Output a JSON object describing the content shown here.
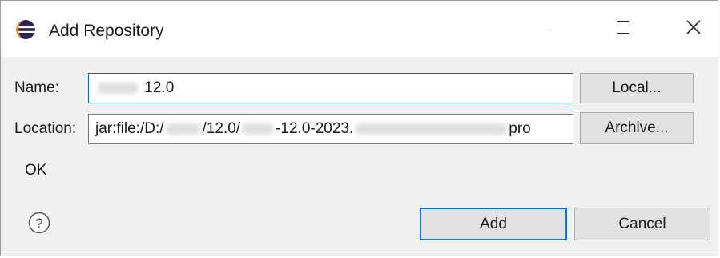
{
  "window": {
    "title": "Add Repository",
    "controls": {
      "minimize": "minimize-icon",
      "maximize": "maximize-icon",
      "close": "close-icon"
    }
  },
  "form": {
    "name_label": "Name:",
    "name_value": "12.0",
    "location_label": "Location:",
    "location_parts": [
      "jar:file:/D:/",
      "/12.0/",
      "-12.0-2023.",
      "pro"
    ],
    "status": "OK"
  },
  "buttons": {
    "local": "Local...",
    "archive": "Archive...",
    "add": "Add",
    "cancel": "Cancel"
  },
  "icons": {
    "app": "eclipse-icon",
    "help": "help-icon"
  },
  "colors": {
    "focus_border": "#0a64c4",
    "default_button_border": "#0078d7"
  }
}
